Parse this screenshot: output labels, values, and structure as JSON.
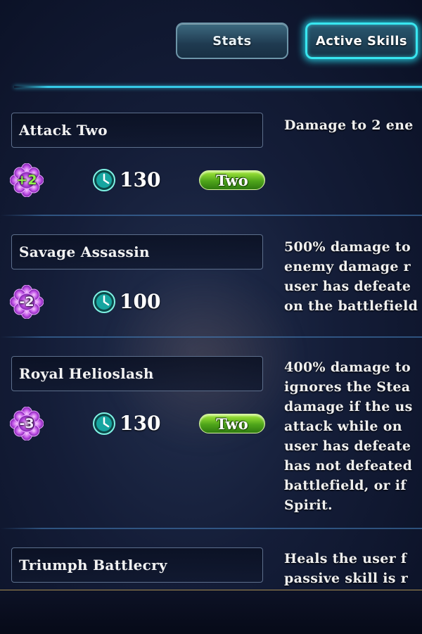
{
  "tabs": {
    "stats_label": "Stats",
    "active_skills_label": "Active Skills"
  },
  "skills": [
    {
      "name": "Attack Two",
      "soul": "+2",
      "cooldown": "130",
      "target": "Two",
      "description": "Damage to 2 ene"
    },
    {
      "name": "Savage Assassin",
      "soul": "-2",
      "cooldown": "100",
      "target": "",
      "description": "500% damage to\nenemy damage r\nuser has defeate\non the battlefield"
    },
    {
      "name": "Royal Helioslash",
      "soul": "-3",
      "cooldown": "130",
      "target": "Two",
      "description": "400% damage to\nignores the Stea\ndamage if the us\nattack while on \nuser has defeate\nhas not defeated\nbattlefield, or if\nSpirit."
    },
    {
      "name": "Triumph Battlecry",
      "soul": "",
      "cooldown": "",
      "target": "",
      "description": "Heals the user f\npassive skill is r"
    }
  ],
  "colors": {
    "accent": "#38e6f0",
    "target_pill": "#6cc62a",
    "soul_positive": "#8ff04c"
  },
  "icons": {
    "soul": "purple-flower-icon",
    "cooldown": "clock-icon"
  }
}
